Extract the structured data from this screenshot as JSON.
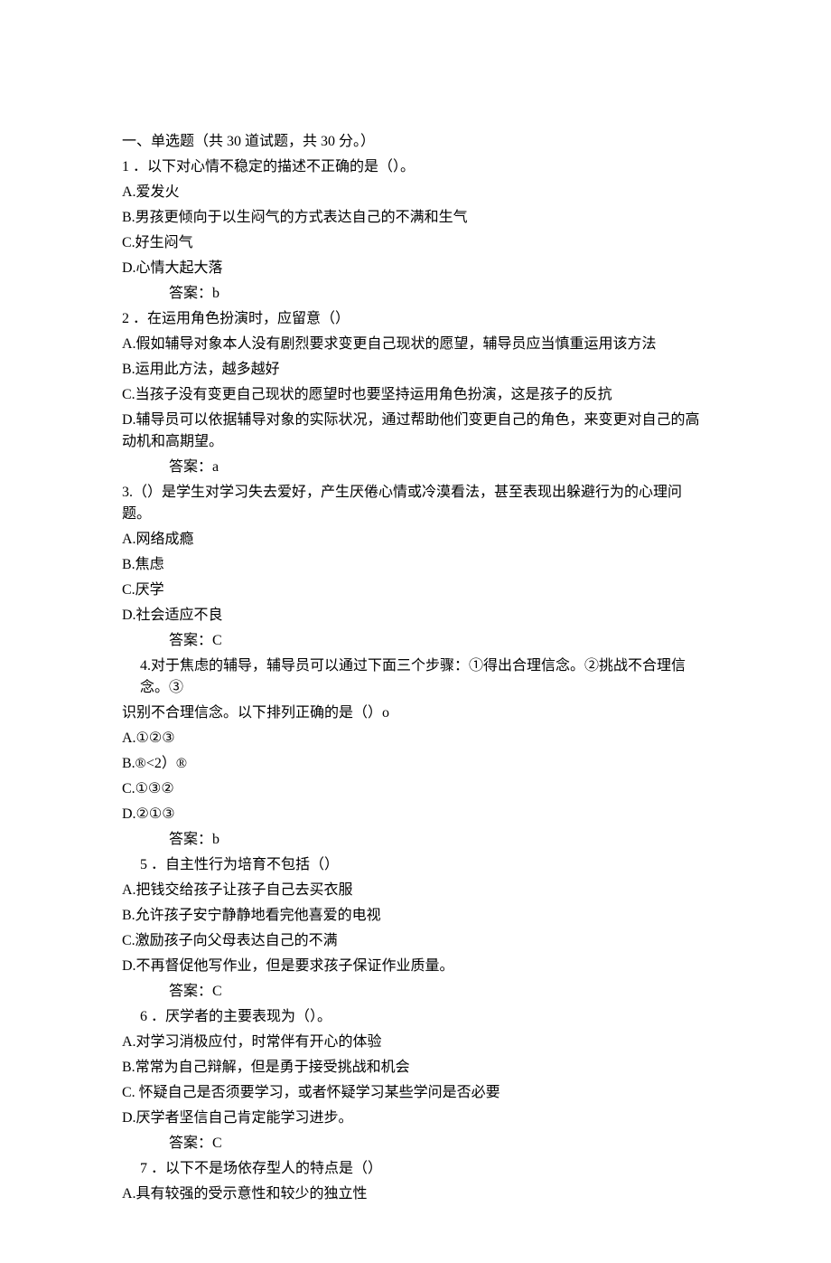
{
  "section_header": "一、单选题（共 30 道试题，共 30 分。）",
  "q1": {
    "num": "1",
    "stem": "．以下对心情不稳定的描述不正确的是（）。",
    "A": "A.爱发火",
    "B": "B.男孩更倾向于以生闷气的方式表达自己的不满和生气",
    "C": "C.好生闷气",
    "D": "D.心情大起大落",
    "ans": "答案：b"
  },
  "q2": {
    "num": "2",
    "stem": "．在运用角色扮演时，应留意（）",
    "A": "A.假如辅导对象本人没有剧烈要求变更自己现状的愿望，辅导员应当慎重运用该方法",
    "B": "B.运用此方法，越多越好",
    "C": "C.当孩子没有变更自己现状的愿望时也要坚持运用角色扮演，这是孩子的反抗",
    "D": "D.辅导员可以依据辅导对象的实际状况，通过帮助他们变更自己的角色，来变更对自己的高动机和高期望。",
    "ans": "答案：a"
  },
  "q3": {
    "stem": "3.（）是学生对学习失去爱好，产生厌倦心情或冷漠看法，甚至表现出躲避行为的心理问题。",
    "A": "A.网络成瘾",
    "B": "B.焦虑",
    "C": "C.厌学",
    "D": "D.社会适应不良",
    "ans": "答案：C"
  },
  "q4": {
    "stem_l1": "4.对于焦虑的辅导，辅导员可以通过下面三个步骤：①得出合理信念。②挑战不合理信念。③",
    "stem_l2": "识别不合理信念。以下排列正确的是（）o",
    "A": "A.①②③",
    "B": "B.®<2）®",
    "C": "C.①③②",
    "D": "D.②①③",
    "ans": "答案：b"
  },
  "q5": {
    "num": "5",
    "stem": "．自主性行为培育不包括（）",
    "A": "A.把钱交给孩子让孩子自己去买衣服",
    "B": "B.允许孩子安宁静静地看完他喜爱的电视",
    "C": "C.激励孩子向父母表达自己的不满",
    "D": "D.不再督促他写作业，但是要求孩子保证作业质量。",
    "ans": "答案：C"
  },
  "q6": {
    "num": "6",
    "stem": "．厌学者的主要表现为（）。",
    "A": "A.对学习消极应付，时常伴有开心的体验",
    "B": "B.常常为自己辩解，但是勇于接受挑战和机会",
    "C": "C. 怀疑自己是否须要学习，或者怀疑学习某些学问是否必要",
    "D": "D.厌学者坚信自己肯定能学习进步。",
    "ans": "答案：C"
  },
  "q7": {
    "num": "7",
    "stem": "．以下不是场依存型人的特点是（）",
    "A": "A.具有较强的受示意性和较少的独立性"
  }
}
